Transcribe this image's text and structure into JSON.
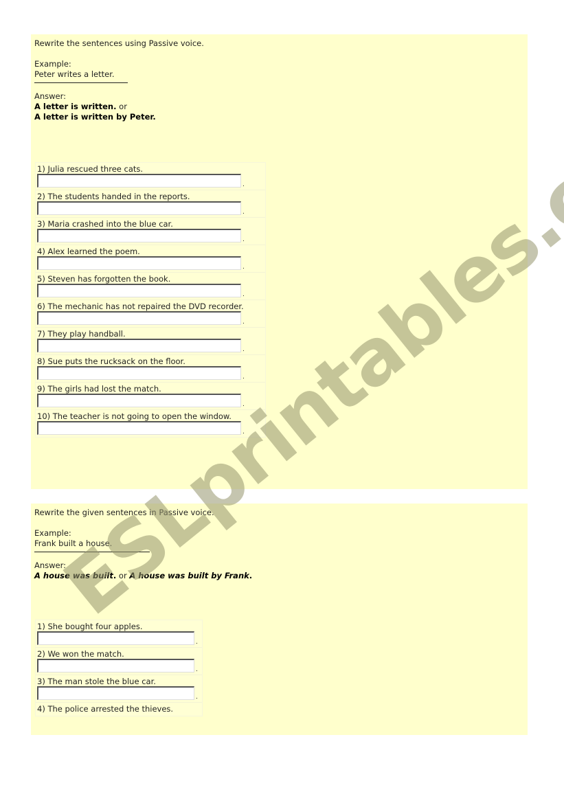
{
  "exercise1": {
    "instruction": "Rewrite the sentences using Passive voice.",
    "example_label": "Example:",
    "example_sentence": "Peter writes a letter.",
    "answer_label": "Answer:",
    "answer_part1": "A letter is written.",
    "answer_or": " or",
    "answer_part2": "A letter is written by Peter.",
    "questions": [
      {
        "text": "1) Julia rescued three cats.",
        "value": ""
      },
      {
        "text": "2) The students handed in the reports.",
        "value": ""
      },
      {
        "text": "3) Maria crashed into the blue car.",
        "value": ""
      },
      {
        "text": "4) Alex learned the poem.",
        "value": ""
      },
      {
        "text": "5) Steven has forgotten the book.",
        "value": ""
      },
      {
        "text": "6) The mechanic has not repaired the DVD recorder.",
        "value": ""
      },
      {
        "text": "7) They play handball.",
        "value": ""
      },
      {
        "text": "8) Sue puts the rucksack on the floor.",
        "value": ""
      },
      {
        "text": "9) The girls had lost the match.",
        "value": ""
      },
      {
        "text": "10) The teacher is not going to open the window.",
        "value": ""
      }
    ]
  },
  "exercise2": {
    "instruction": "Rewrite the given sentences in Passive voice.",
    "example_label": "Example:",
    "example_sentence": "Frank built a house.",
    "answer_label": "Answer:",
    "answer_part1": "A house was built",
    "answer_dot1": ".",
    "answer_or": " or ",
    "answer_part2": "A house was built by Frank",
    "answer_dot2": ".",
    "questions": [
      {
        "text": "1) She bought four apples.",
        "value": ""
      },
      {
        "text": "2) We won the match.",
        "value": ""
      },
      {
        "text": "3) The man stole the blue car.",
        "value": ""
      },
      {
        "text": "4) The police arrested the thieves.",
        "value": ""
      }
    ]
  },
  "input_suffix": ".",
  "watermark": "ESLprintables.com",
  "colors": {
    "panel_background": "#ffffcc",
    "watermark": "#a8a886"
  }
}
